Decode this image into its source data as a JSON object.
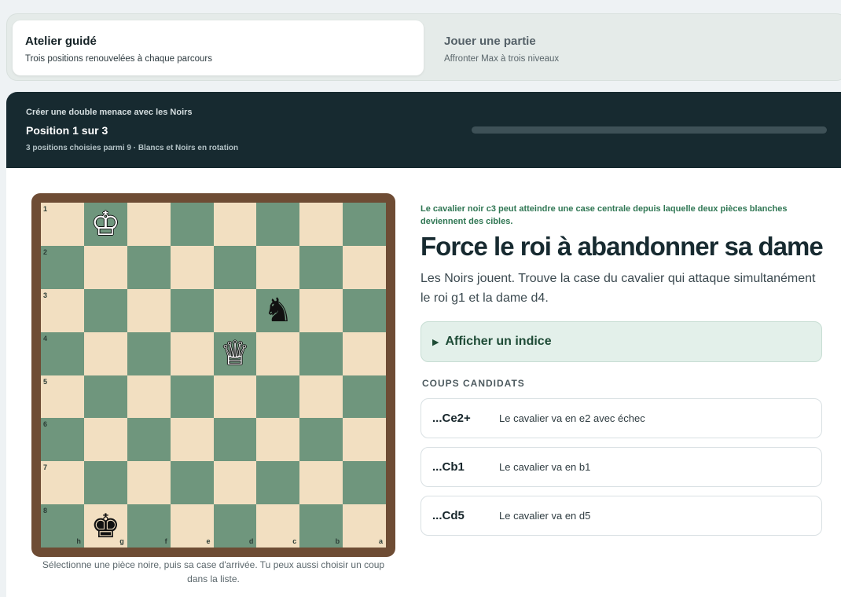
{
  "modes": [
    {
      "title": "Atelier guidé",
      "subtitle": "Trois positions renouvelées à chaque parcours",
      "active": true
    },
    {
      "title": "Jouer une partie",
      "subtitle": "Affronter Max à trois niveaux",
      "active": false
    }
  ],
  "header": {
    "kicker": "Créer une double menace avec les Noirs",
    "title": "Position 1 sur 3",
    "subtitle": "3 positions choisies parmi 9 · Blancs et Noirs en rotation",
    "progress_fraction": 0,
    "colors": {
      "bg": "#172a30",
      "track": "#3e5157",
      "accent": "#6fb194"
    }
  },
  "board": {
    "orientation": "black",
    "ranks": [
      "1",
      "2",
      "3",
      "4",
      "5",
      "6",
      "7",
      "8"
    ],
    "files": [
      "h",
      "g",
      "f",
      "e",
      "d",
      "c",
      "b",
      "a"
    ],
    "pieces": [
      {
        "square": "g1",
        "glyph": "♔",
        "color": "white",
        "icon": "white-king-icon"
      },
      {
        "square": "d4",
        "glyph": "♕",
        "color": "white",
        "icon": "white-queen-icon"
      },
      {
        "square": "c3",
        "glyph": "♞",
        "color": "black",
        "icon": "black-knight-icon"
      },
      {
        "square": "g8",
        "glyph": "♚",
        "color": "black",
        "icon": "black-king-icon"
      }
    ],
    "colors": {
      "light": "#f2dfc1",
      "dark": "#6f967d",
      "frame": "#6e4c34"
    },
    "hint": "Sélectionne une pièce noire, puis sa case d'arrivée. Tu peux aussi choisir un coup dans la liste."
  },
  "puzzle": {
    "kicker": "Le cavalier noir c3 peut atteindre une case centrale depuis laquelle deux pièces blanches deviennent des cibles.",
    "headline": "Force le roi à abandonner sa dame",
    "prompt": "Les Noirs jouent. Trouve la case du cavalier qui attaque simultanément le roi g1 et la dame d4.",
    "hint_label": "Afficher un indice",
    "candidates_title": "COUPS CANDIDATS",
    "candidates": [
      {
        "san": "...Ce2+",
        "desc": "Le cavalier va en e2 avec échec"
      },
      {
        "san": "...Cb1",
        "desc": "Le cavalier va en b1"
      },
      {
        "san": "...Cd5",
        "desc": "Le cavalier va en d5"
      }
    ]
  }
}
